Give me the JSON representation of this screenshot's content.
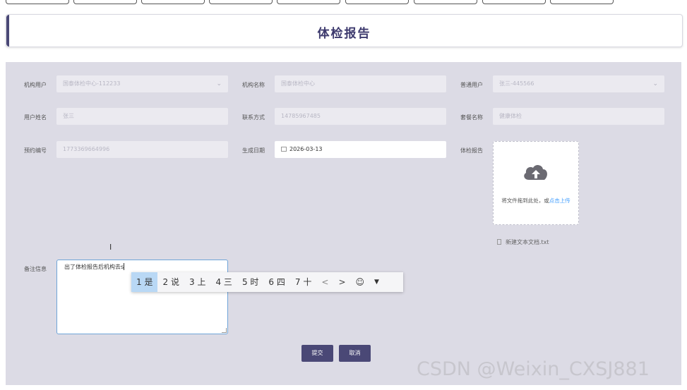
{
  "page_title": "体检报告",
  "form": {
    "org_user_label": "机构用户",
    "org_user_value": "国泰体检中心-112233",
    "org_name_label": "机构名称",
    "org_name_value": "国泰体检中心",
    "normal_user_label": "普通用户",
    "normal_user_value": "张三-445566",
    "user_name_label": "用户姓名",
    "user_name_value": "张三",
    "contact_label": "联系方式",
    "contact_value": "14785967485",
    "package_label": "套餐名称",
    "package_value": "健康体检",
    "booking_no_label": "预约编号",
    "booking_no_value": "1773369664996",
    "gen_date_label": "生成日期",
    "gen_date_value": "2026-03-13",
    "report_label": "体检报告",
    "upload_text": "将文件拖到此处，或",
    "upload_link": "点击上传",
    "uploaded_file": "新建文本文档.txt",
    "notes_label": "备注信息",
    "notes_value": "出了体检报告后机构去s"
  },
  "ime": {
    "candidates": [
      {
        "num": "1",
        "text": "是"
      },
      {
        "num": "2",
        "text": "说"
      },
      {
        "num": "3",
        "text": "上"
      },
      {
        "num": "4",
        "text": "三"
      },
      {
        "num": "5",
        "text": "时"
      },
      {
        "num": "6",
        "text": "四"
      },
      {
        "num": "7",
        "text": "十"
      }
    ],
    "prev": "<",
    "next": ">",
    "emoji": "☺",
    "menu": "▼"
  },
  "buttons": {
    "submit": "提交",
    "cancel": "取消"
  },
  "watermark": "CSDN @Weixin_CXSJ881",
  "colors": {
    "primary": "#4a4876",
    "panel": "#dcdbe5",
    "link": "#409eff",
    "ime_selected": "#b9d8f5"
  }
}
